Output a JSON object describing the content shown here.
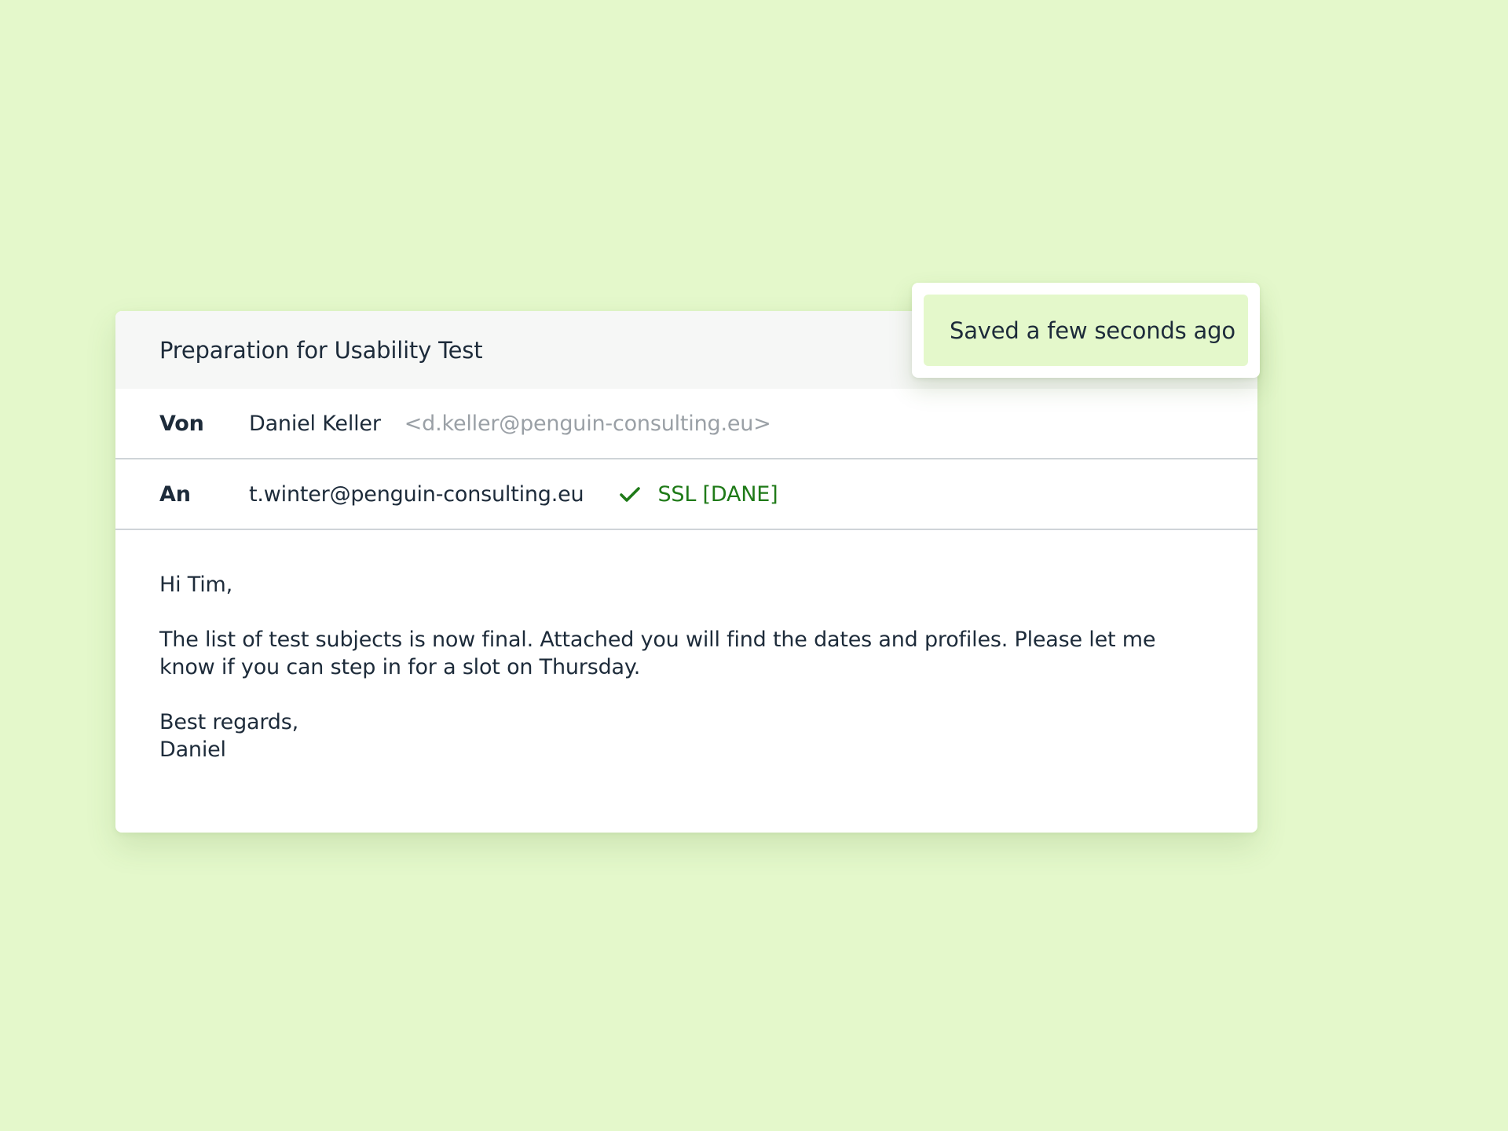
{
  "mail": {
    "subject": "Preparation for Usability Test",
    "from": {
      "label": "Von",
      "name": "Daniel Keller",
      "email": "<d.keller@penguin-consulting.eu>"
    },
    "to": {
      "label": "An",
      "email": "t.winter@penguin-consulting.eu",
      "security_icon": "check-icon",
      "security_label": "SSL [DANE]"
    },
    "body": {
      "greeting": "Hi Tim,",
      "paragraph": "The list of test subjects is now final. Attached you will find the dates and profiles. Please let me know if you can step in for a slot on Thursday.",
      "closing": "Best regards,",
      "signature": "Daniel"
    }
  },
  "toast": {
    "message": "Saved a few seconds ago"
  },
  "colors": {
    "background": "#e4f8cb",
    "text": "#1d2b3a",
    "muted_text": "#9aa0a6",
    "success": "#1f7a18",
    "subject_bar": "#f6f7f6"
  }
}
